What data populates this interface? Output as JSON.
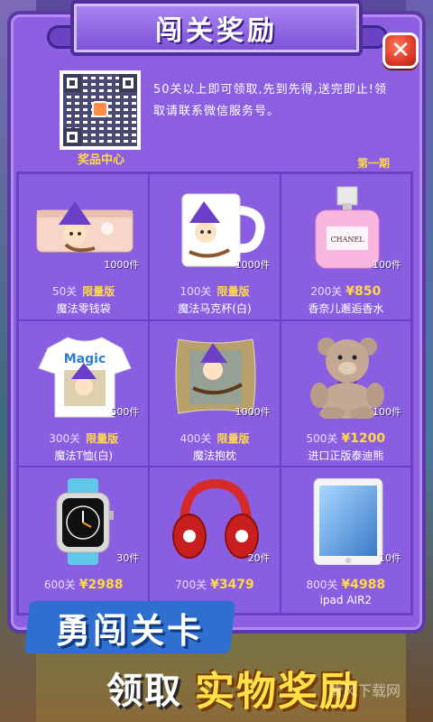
{
  "title": "闯关奖励",
  "close_label": "✕",
  "qr": {
    "label": "奖品中心"
  },
  "notice": "50关以上即可领取,先到先得,送完即止!领取请联系微信服务号。",
  "issue": "第一期",
  "products": [
    {
      "name": "魔法零钱袋",
      "level": "50关",
      "tag": "限量版",
      "price": "",
      "qty": "1000件",
      "icon": "pouch-icon"
    },
    {
      "name": "魔法马克杯(白)",
      "level": "100关",
      "tag": "限量版",
      "price": "",
      "qty": "1000件",
      "icon": "mug-icon"
    },
    {
      "name": "香奈儿邂逅香水",
      "level": "200关",
      "tag": "",
      "price": "¥850",
      "qty": "100件",
      "icon": "perfume-icon"
    },
    {
      "name": "魔法T恤(白)",
      "level": "300关",
      "tag": "限量版",
      "price": "",
      "qty": "500件",
      "icon": "tshirt-icon"
    },
    {
      "name": "魔法抱枕",
      "level": "400关",
      "tag": "限量版",
      "price": "",
      "qty": "1000件",
      "icon": "pillow-icon"
    },
    {
      "name": "进口正版泰迪熊",
      "level": "500关",
      "tag": "",
      "price": "¥1200",
      "qty": "100件",
      "icon": "teddy-bear-icon"
    },
    {
      "name": "",
      "level": "600关",
      "tag": "",
      "price": "¥2988",
      "qty": "30件",
      "icon": "smartwatch-icon"
    },
    {
      "name": "",
      "level": "700关",
      "tag": "",
      "price": "¥3479",
      "qty": "20件",
      "icon": "headphones-icon"
    },
    {
      "name": "ipad AIR2",
      "level": "800关",
      "tag": "",
      "price": "¥4988",
      "qty": "10件",
      "icon": "tablet-icon"
    }
  ],
  "tshirt_text": "Magic",
  "perfume_text": "CHANEL",
  "promo": {
    "line1": "勇闯关卡",
    "line2a": "领取",
    "line2b": "实物奖励"
  },
  "watermark": "清风下载网",
  "colors": {
    "panel": "#8c5fe0",
    "accent_yellow": "#ffd84a",
    "close_red": "#e03a2a",
    "promo_blue": "#2f6fd0"
  }
}
